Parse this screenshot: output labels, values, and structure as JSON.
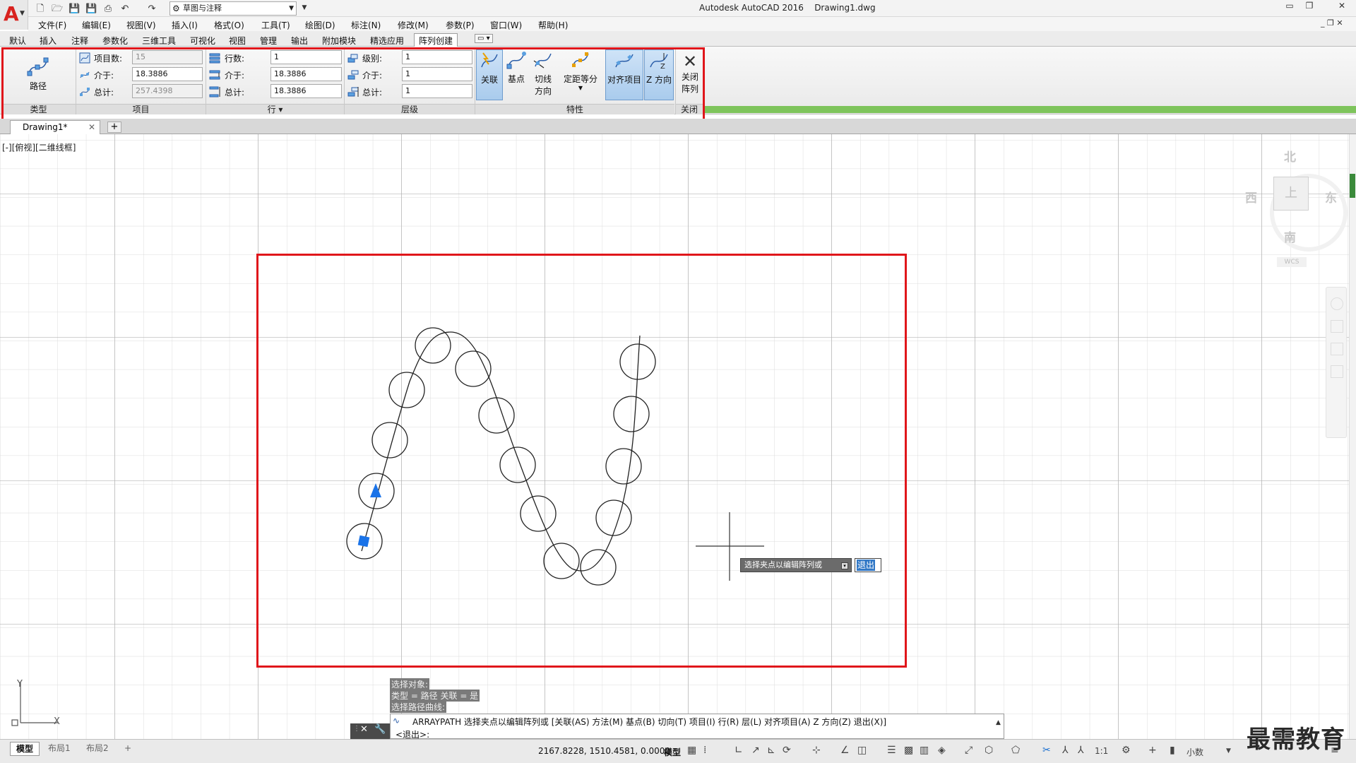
{
  "titlebar": {
    "app_title": "Autodesk AutoCAD 2016",
    "file_name": "Drawing1.dwg",
    "workspace": "草图与注释"
  },
  "menu": [
    "文件(F)",
    "编辑(E)",
    "视图(V)",
    "插入(I)",
    "格式(O)",
    "工具(T)",
    "绘图(D)",
    "标注(N)",
    "修改(M)",
    "参数(P)",
    "窗口(W)",
    "帮助(H)"
  ],
  "ribbon_tabs": [
    "默认",
    "插入",
    "注释",
    "参数化",
    "三维工具",
    "可视化",
    "视图",
    "管理",
    "输出",
    "附加模块",
    "精选应用",
    "阵列创建"
  ],
  "ribbon": {
    "type_button": "路径",
    "type_title": "类型",
    "items": {
      "count_label": "项目数:",
      "count_value": "15",
      "between_label": "介于:",
      "between_value": "18.3886",
      "total_label": "总计:",
      "total_value": "257.4398",
      "title": "项目"
    },
    "rows": {
      "count_label": "行数:",
      "count_value": "1",
      "between_label": "介于:",
      "between_value": "18.3886",
      "total_label": "总计:",
      "total_value": "18.3886",
      "title": "行 ▾"
    },
    "levels": {
      "count_label": "级别:",
      "count_value": "1",
      "between_label": "介于:",
      "between_value": "1",
      "total_label": "总计:",
      "total_value": "1",
      "title": "层级"
    },
    "properties": {
      "associative": "关联",
      "basepoint": "基点",
      "tangent1": "切线",
      "tangent2": "方向",
      "measure": "定距等分",
      "align": "对齐项目",
      "zdir": "Z 方向",
      "title": "特性"
    },
    "close": {
      "label1": "关闭",
      "label2": "阵列",
      "title": "关闭"
    }
  },
  "doc_tab": "Drawing1*",
  "view_label": "[-][俯视][二维线框]",
  "viewcube": {
    "north": "北",
    "south": "南",
    "east": "东",
    "west": "西",
    "top": "上",
    "wcs": "WCS"
  },
  "history": [
    "选择对象:",
    "类型 = 路径  关联 = 是",
    "选择路径曲线:"
  ],
  "command": {
    "line1": "ARRAYPATH 选择夹点以编辑阵列或 [关联(AS) 方法(M) 基点(B) 切向(T) 项目(I) 行(R) 层(L) 对齐项目(A) Z 方向(Z) 退出(X)]",
    "line2": "<退出>:"
  },
  "tooltip": {
    "prompt": "选择夹点以编辑阵列或",
    "input": "退出"
  },
  "layout_tabs": [
    "模型",
    "布局1",
    "布局2"
  ],
  "status": {
    "coords": "2167.8228, 1510.4581, 0.0000",
    "model": "模型",
    "scale": "1:1",
    "units": "小数"
  },
  "watermark": "最需教育",
  "colors": {
    "highlight_red": "#e0161b",
    "grip_blue": "#1a73e8",
    "ribbon_green": "#7ec45c"
  }
}
